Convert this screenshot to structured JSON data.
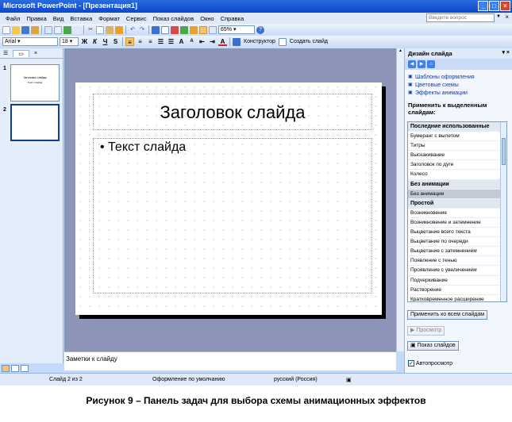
{
  "window": {
    "title": "Microsoft PowerPoint - [Презентация1]",
    "min": "_",
    "max": "□",
    "close": "×"
  },
  "menu": {
    "items": [
      "Файл",
      "Правка",
      "Вид",
      "Вставка",
      "Формат",
      "Сервис",
      "Показ слайдов",
      "Окно",
      "Справка"
    ],
    "help_placeholder": "Введите вопрос",
    "close_doc": "×"
  },
  "toolbar1": {
    "zoom": "65%",
    "zoom_arrow": "▾"
  },
  "toolbar2": {
    "font": "Arial",
    "font_arrow": "▾",
    "size": "18",
    "size_arrow": "▾",
    "bold": "Ж",
    "italic": "К",
    "underline": "Ч",
    "shadow": "S",
    "designer": "Конструктор",
    "new_slide": "Создать слайд"
  },
  "thumbnails": {
    "tab_close": "×",
    "slides": [
      {
        "num": "1",
        "title": "Заголовок слайда",
        "sub": "Текст слайда"
      },
      {
        "num": "2"
      }
    ]
  },
  "slide": {
    "title": "Заголовок слайда",
    "bullet": "• Текст слайда"
  },
  "notes_placeholder": "Заметки к слайду",
  "status": {
    "slide": "Слайд 2 из 2",
    "design": "Оформление по умолчанию",
    "language": "русский (Россия)"
  },
  "taskpane": {
    "title": "Дизайн слайда",
    "ctl": "▾ ×",
    "links": [
      "Шаблоны оформления",
      "Цветовые схемы",
      "Эффекты анимации"
    ],
    "apply_label": "Применить к выделенным слайдам:",
    "list": [
      {
        "text": "Последние использованные",
        "hdr": true
      },
      {
        "text": "Бумеранг с вылетом"
      },
      {
        "text": "Титры"
      },
      {
        "text": "Выскакивание"
      },
      {
        "text": "Заголовок по дуге"
      },
      {
        "text": "Колесо"
      },
      {
        "text": "Без анимации",
        "hdr": true
      },
      {
        "text": "Без анимации",
        "sel": true
      },
      {
        "text": "Простой",
        "hdr": true
      },
      {
        "text": "Возникновение"
      },
      {
        "text": "Возникновение и затемнение"
      },
      {
        "text": "Выцветание всего текста"
      },
      {
        "text": "Выцветание по очереди"
      },
      {
        "text": "Выцветание с затемнением"
      },
      {
        "text": "Появление с тенью"
      },
      {
        "text": "Проявление с увеличением"
      },
      {
        "text": "Подчеркивание"
      },
      {
        "text": "Растворение"
      },
      {
        "text": "Кратковременное расширение"
      }
    ],
    "apply_all": "Применить ко всем слайдам",
    "preview": "Просмотр",
    "slideshow": "Показ слайдов",
    "autopreview": "Автопросмотр",
    "autopreview_check": "✓"
  },
  "caption": "Рисунок 9 – Панель задач для выбора схемы анимационных  эффектов"
}
